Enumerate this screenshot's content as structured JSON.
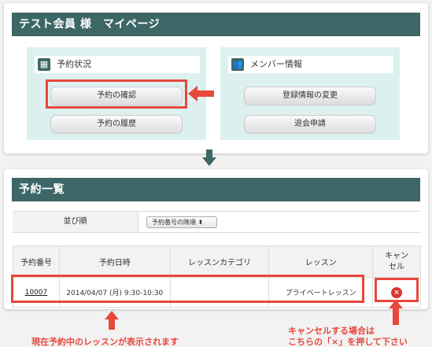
{
  "header": {
    "title": "テスト会員 様　マイページ"
  },
  "left_panel": {
    "title": "予約状況",
    "buttons": {
      "confirm": "予約の確認",
      "history": "予約の履歴"
    }
  },
  "right_panel": {
    "title": "メンバー情報",
    "buttons": {
      "change": "登録情報の変更",
      "withdraw": "退会申請"
    }
  },
  "list": {
    "title": "予約一覧",
    "sort_label": "並び順",
    "sort_value": "予約番号の降順 ⬍",
    "columns": [
      "予約番号",
      "予約日時",
      "レッスンカテゴリ",
      "レッスン",
      "キャンセル"
    ],
    "rows": [
      {
        "number": "10007",
        "datetime": "2014/04/07 (月) 9:30-10:30",
        "category": "",
        "lesson": "プライベートレッスン",
        "cancel_icon": "×"
      }
    ]
  },
  "annotations": {
    "current": "現在予約中のレッスンが表示されます",
    "cancel_line1": "キャンセルする場合は",
    "cancel_line2": "こちらの「×」を押して下さい"
  },
  "colors": {
    "header": "#3d6766",
    "accent": "#e8473c",
    "panel": "#dcf1ef"
  }
}
